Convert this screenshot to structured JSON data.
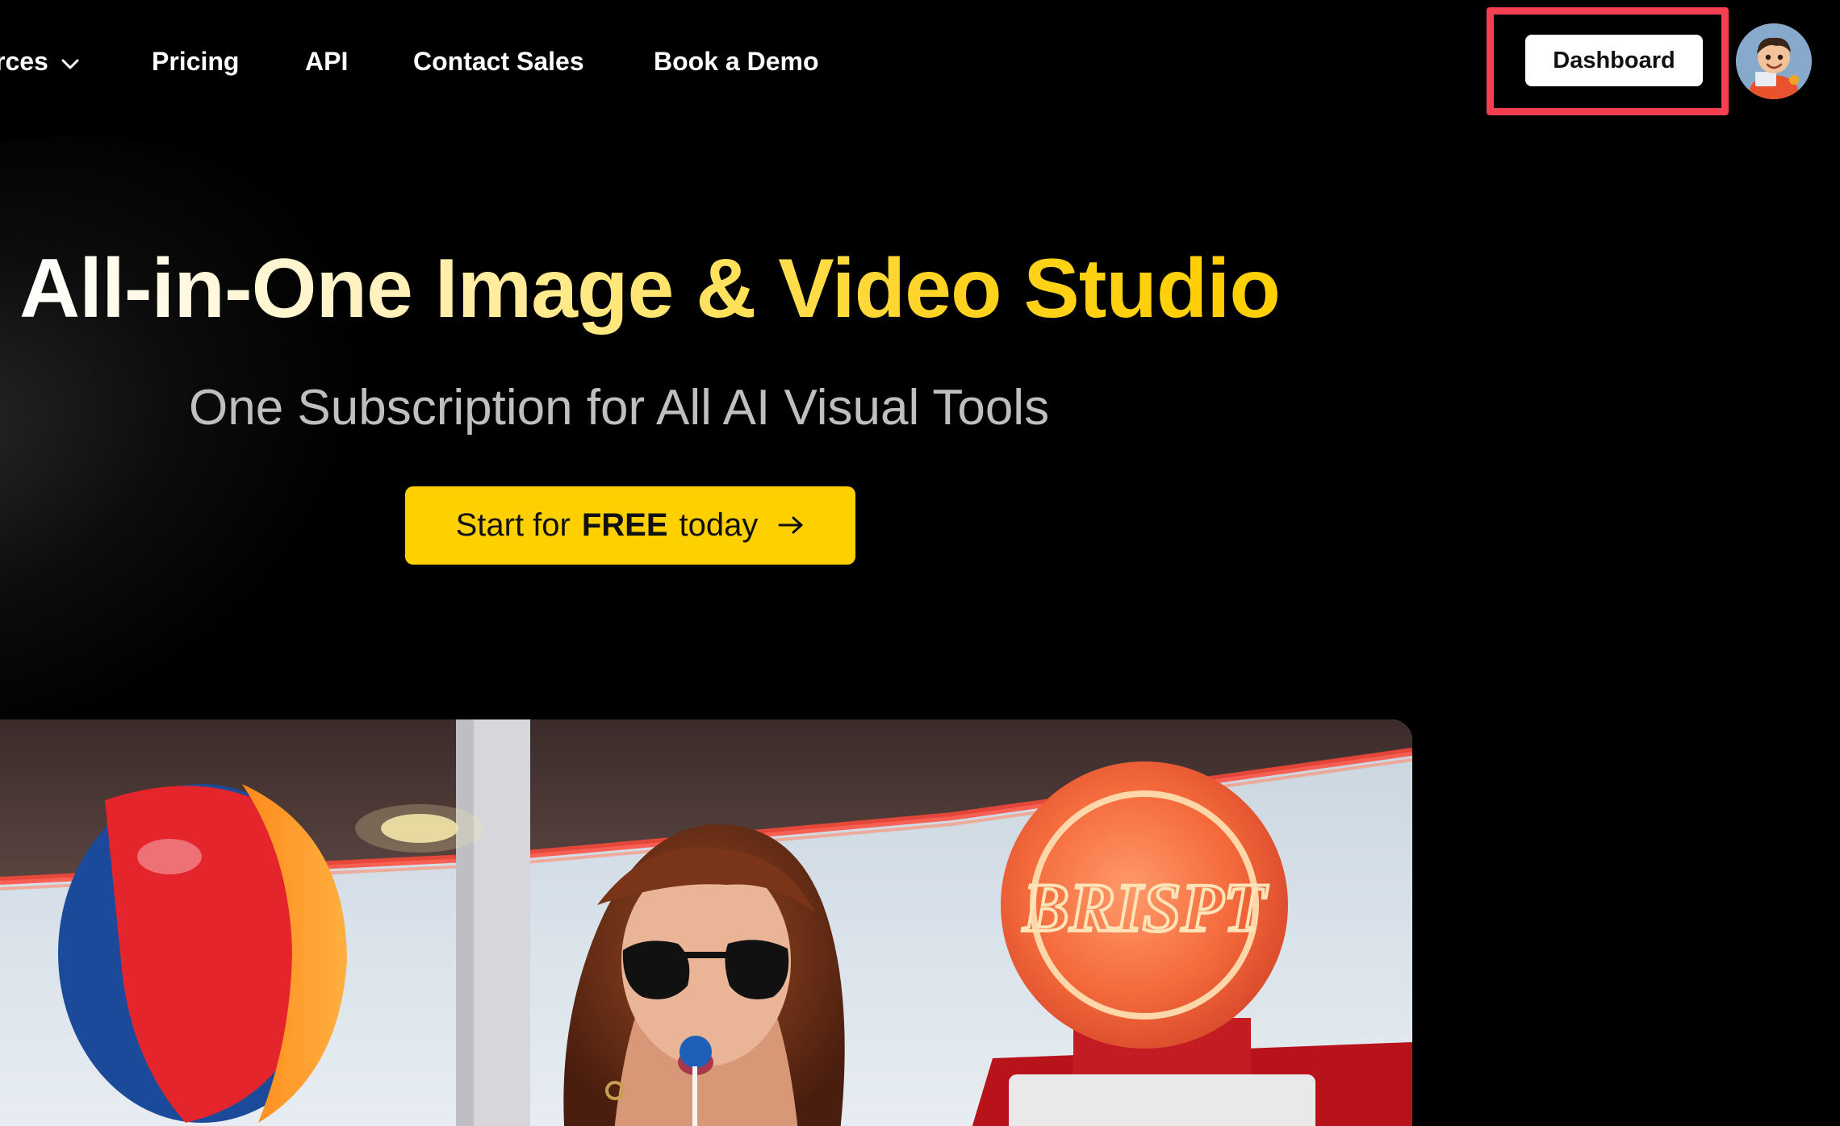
{
  "nav": {
    "items": [
      {
        "label": "rces",
        "has_dropdown": true
      },
      {
        "label": "Pricing"
      },
      {
        "label": "API"
      },
      {
        "label": "Contact Sales"
      },
      {
        "label": "Book a Demo"
      }
    ]
  },
  "header": {
    "dashboard_label": "Dashboard",
    "highlight_color": "#f43f52"
  },
  "hero": {
    "title": "All-in-One Image & Video Studio",
    "subtitle": "One Subscription for All AI Visual Tools",
    "cta": {
      "prefix": "Start for",
      "emphasis": "FREE",
      "suffix": "today"
    }
  },
  "showcase": {
    "sign_text": "BRISPT"
  },
  "colors": {
    "background": "#000000",
    "accent": "#ffd000",
    "text": "#ffffff",
    "subtitle": "#bfbfbf"
  },
  "icons": {
    "dropdown": "chevron-down-icon",
    "cta_arrow": "arrow-right-icon",
    "avatar": "avatar-icon"
  }
}
